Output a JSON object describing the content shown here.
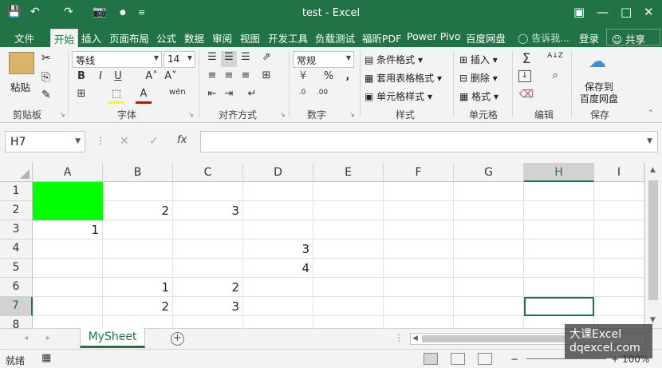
{
  "titlebar": {
    "title": "test - Excel",
    "save_icon": "💾",
    "undo_icon": "↶",
    "redo_icon": "↷",
    "camera_icon": "📷",
    "dot_icon": "●",
    "customize_icon": "≡",
    "ribbon_display_icon": "▣",
    "minimize_icon": "—",
    "restore_icon": "□",
    "close_icon": "✕"
  },
  "tabs": {
    "file": "文件",
    "home": "开始",
    "insert": "插入",
    "page_layout": "页面布局",
    "formulas": "公式",
    "data": "数据",
    "review": "审阅",
    "view": "视图",
    "developer": "开发工具",
    "load_test": "负载测试",
    "foxit_pdf": "福昕PDF",
    "power_pivot": "Power Pivo",
    "baidu_disk": "百度网盘",
    "tell_me": "告诉我...",
    "login": "登录",
    "share": "共享"
  },
  "ribbon": {
    "clipboard": {
      "label": "剪贴板",
      "paste": "粘贴",
      "cut_icon": "✂",
      "copy_icon": "⎘",
      "painter_icon": "✎"
    },
    "font": {
      "label": "字体",
      "font_name": "等线",
      "font_size": "14",
      "bold": "B",
      "italic": "I",
      "underline": "U",
      "grow": "A˄",
      "shrink": "A˅",
      "wen": "wén",
      "border_icon": "⊞",
      "fill_icon": "⬚",
      "font_color": "A"
    },
    "alignment": {
      "label": "对齐方式"
    },
    "number": {
      "label": "数字",
      "format": "常规",
      "currency_icon": "¥",
      "percent": "%",
      "comma": ",",
      "inc_decimal": ".0",
      "dec_decimal": ".00"
    },
    "styles": {
      "label": "样式",
      "conditional": "条件格式",
      "table": "套用表格格式",
      "cell_styles": "单元格样式"
    },
    "cells": {
      "label": "单元格",
      "insert": "插入",
      "delete": "删除",
      "format": "格式"
    },
    "editing": {
      "label": "编辑",
      "sum_icon": "Σ",
      "fill_icon": "↓",
      "clear_icon": "⌫",
      "sort_icon": "A↓Z",
      "find_icon": "⌕"
    },
    "save": {
      "label": "保存",
      "save_to_line1": "保存到",
      "save_to_line2": "百度网盘"
    }
  },
  "formula_bar": {
    "name_box": "H7",
    "cancel_icon": "✕",
    "enter_icon": "✓",
    "fx": "fx",
    "value": ""
  },
  "grid": {
    "columns": [
      "A",
      "B",
      "C",
      "D",
      "E",
      "F",
      "G",
      "H",
      "I"
    ],
    "rows": [
      "1",
      "2",
      "3",
      "4",
      "5",
      "6",
      "7",
      "8"
    ],
    "selected_cell": "H7",
    "fill_color": "#00ff00",
    "cells": {
      "B2": "2",
      "C2": "3",
      "A3": "1",
      "D4": "3",
      "D5": "4",
      "B6": "1",
      "C6": "2",
      "B7": "2",
      "C7": "3"
    }
  },
  "sheets": {
    "active": "MySheet",
    "add_icon": "+",
    "prev_icon": "◂",
    "next_icon": "▸",
    "dots": "⋮"
  },
  "status": {
    "ready": "就绪",
    "macro_icon": "▦",
    "zoom": "100%",
    "zoom_minus": "−",
    "zoom_plus": "+"
  },
  "watermark": {
    "line1": "大课Excel",
    "line2": "dqexcel.com"
  },
  "colors": {
    "excel_green": "#217346",
    "cell_fill": "#00ff00",
    "ribbon_bg": "#f3f3f3"
  }
}
